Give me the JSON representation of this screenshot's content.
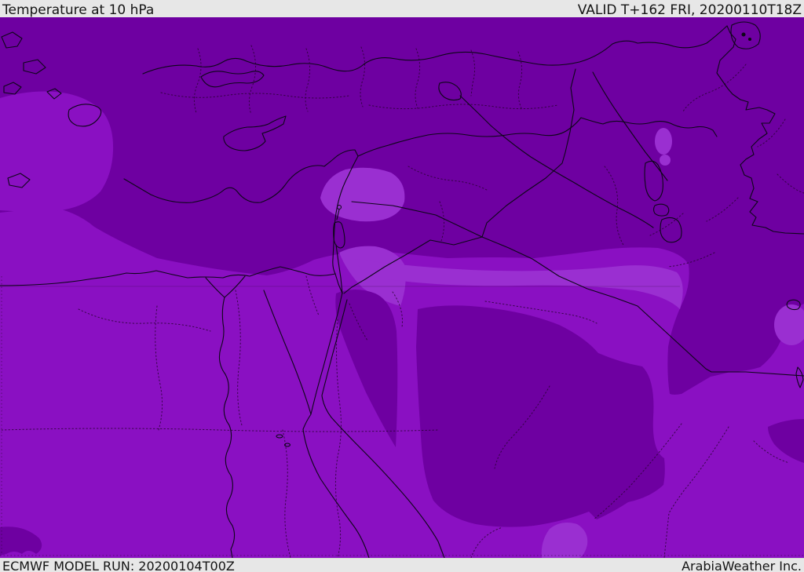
{
  "header": {
    "title": "Temperature at 10 hPa",
    "valid": "VALID T+162 FRI, 20200110T18Z"
  },
  "footer": {
    "model_run": "ECMWF MODEL RUN: 20200104T00Z",
    "provider": "ArabiaWeather Inc."
  },
  "map": {
    "region": "Middle East / Eastern Mediterranean",
    "colors": {
      "shade_cold_dark": "#6e00a1",
      "shade_mid": "#8a10c2",
      "shade_warm_light": "#9a2fd1",
      "coastline": "#0d0618",
      "admin_boundary": "#26032e",
      "gridline": "#2a0a33",
      "bar_background": "#e7e7e7",
      "bar_text": "#141414"
    },
    "shading_levels": [
      {
        "name": "coldest",
        "color": "#6e00a1"
      },
      {
        "name": "middle",
        "color": "#8a10c2"
      },
      {
        "name": "warmest",
        "color": "#9a2fd1"
      }
    ]
  }
}
